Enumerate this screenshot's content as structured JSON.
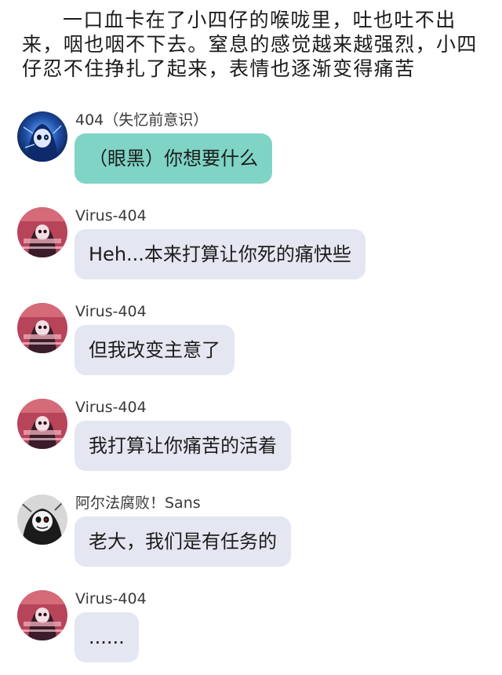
{
  "narration": "一口血卡在了小四仔的喉咙里，吐也吐不出来，咽也咽不下去。窒息的感觉越来越强烈，小四仔忍不住挣扎了起来，表情也逐渐变得痛苦",
  "messages": [
    {
      "sender": "404（失忆前意识）",
      "text": "（眼黑）你想要什么",
      "avatar": "blue-hooded-avatar",
      "bubble_color": "#7fd4c6"
    },
    {
      "sender": "Virus-404",
      "text": "Heh...本来打算让你死的痛快些",
      "avatar": "red-glitch-avatar",
      "bubble_color": "#e4e7f1"
    },
    {
      "sender": "Virus-404",
      "text": "但我改变主意了",
      "avatar": "red-glitch-avatar",
      "bubble_color": "#e4e7f1"
    },
    {
      "sender": "Virus-404",
      "text": "我打算让你痛苦的活着",
      "avatar": "red-glitch-avatar",
      "bubble_color": "#e4e7f1"
    },
    {
      "sender": "阿尔法腐败！Sans",
      "text": "老大，我们是有任务的",
      "avatar": "monochrome-skull-avatar",
      "bubble_color": "#e4e7f1"
    },
    {
      "sender": "Virus-404",
      "text": "......",
      "avatar": "red-glitch-avatar",
      "bubble_color": "#e4e7f1"
    }
  ]
}
